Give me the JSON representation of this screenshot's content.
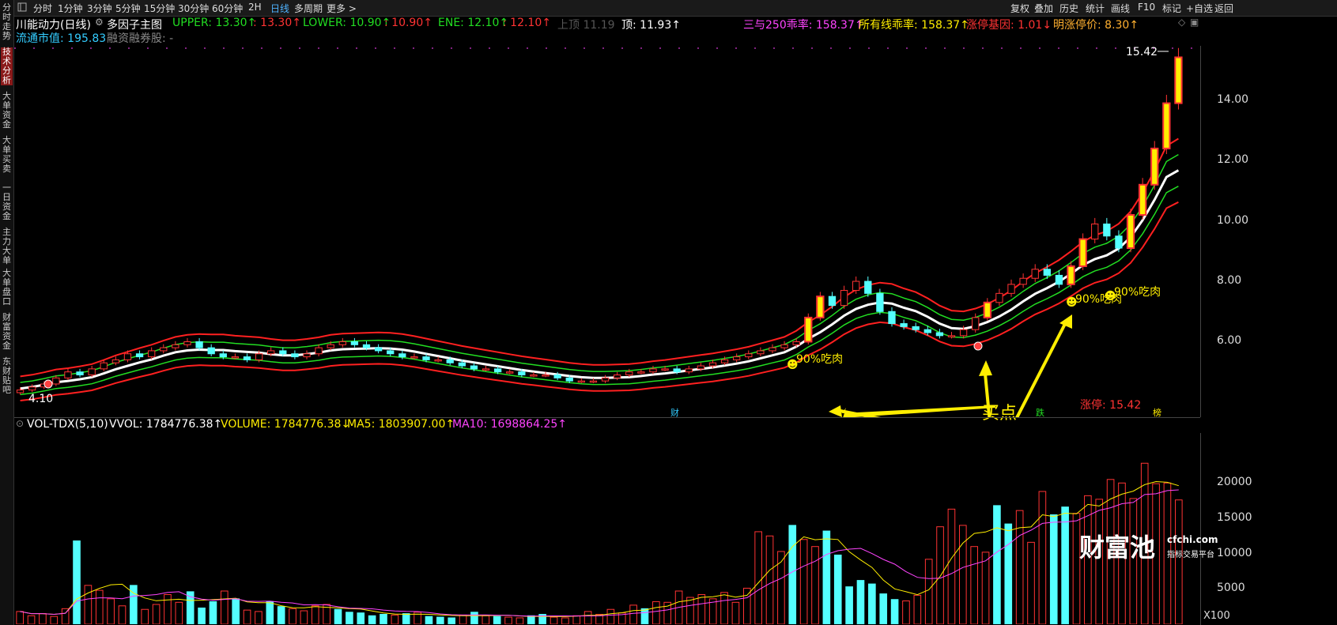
{
  "toolbar": {
    "left_icon": "layout-icon",
    "periods": [
      "分时",
      "1分钟",
      "3分钟",
      "5分钟",
      "15分钟",
      "30分钟",
      "60分钟",
      "2H",
      "日线",
      "多周期",
      "更多 >"
    ],
    "active_period": "日线",
    "right_items": [
      "复权",
      "叠加",
      "历史",
      "统计",
      "画线",
      "F10",
      "标记",
      "+自选",
      "返回"
    ]
  },
  "left_tabs": [
    "分时走势",
    "技术分析",
    "大单资金",
    "大单买卖",
    "一日资金",
    "主力大单",
    "大单盘口",
    "财富资金",
    "东财贴吧"
  ],
  "active_left_tab": "技术分析",
  "info_row1": {
    "stock_name": "川能动力(日线)",
    "factor_label": "多因子主图",
    "upper": "UPPER: 13.30↑",
    "upper2": ": 13.30↑",
    "lower": "LOWER: 10.90↑",
    "lower2": ": 10.90↑",
    "ene": "ENE: 12.10↑",
    "ene2": ": 12.10↑",
    "top": "顶: 11.93↑",
    "faded": "上顶 11.19",
    "sanyu": "三与250乖率: 158.37↑",
    "all_line": "所有线乖率: 158.37↑",
    "limit_gene": "涨停基因: 1.01↓",
    "next_limit": "明涨停价: 8.30↑"
  },
  "info_row2": {
    "float_cap": "流通市值: 195.83",
    "margin": "融资融券股: -"
  },
  "y_axis_main": [
    "14.00",
    "12.00",
    "10.00",
    "8.00",
    "6.00"
  ],
  "high_label": "15.42",
  "low_label": "4.10",
  "annotations": {
    "eat1": "90%吃肉",
    "eat2": "90%吃肉",
    "eat3": "90%吃肉",
    "buy_point": "买点",
    "limit_up": "涨停: 15.42",
    "marker_cai": "财",
    "marker_die": "跌",
    "marker_bang": "榜"
  },
  "vol_header": {
    "name": "VOL-TDX(5,10)",
    "vvol": "VVOL: 1784776.38↑",
    "volume": "VOLUME: 1784776.38↓",
    "ma5": "MA5: 1803907.00↑",
    "ma10": "MA10: 1698864.25↑"
  },
  "y_axis_vol": [
    "20000",
    "15000",
    "10000",
    "5000"
  ],
  "vol_unit": "X100",
  "watermark": {
    "brand": "财富池",
    "site": "cfchi.com",
    "tagline": "指标交易平台"
  },
  "colors": {
    "up": "#ff3333",
    "down": "#54ffff",
    "upper": "#ff2020",
    "mid": "#ffffff",
    "lower": "#22dd22",
    "yellow": "#ffee00",
    "magenta": "#ff44ff",
    "cyan": "#33ccff"
  },
  "chart_data": {
    "type": "candlestick",
    "y_range": [
      3.5,
      15.8
    ],
    "candles_close_approx": [
      4.4,
      4.5,
      4.6,
      4.8,
      5.0,
      4.9,
      5.1,
      5.3,
      5.4,
      5.6,
      5.5,
      5.7,
      5.8,
      5.9,
      6.0,
      5.8,
      5.6,
      5.5,
      5.5,
      5.4,
      5.6,
      5.7,
      5.6,
      5.5,
      5.6,
      5.8,
      5.9,
      6.0,
      5.9,
      5.8,
      5.7,
      5.6,
      5.5,
      5.5,
      5.4,
      5.4,
      5.3,
      5.2,
      5.1,
      5.1,
      5.0,
      5.0,
      4.9,
      4.9,
      4.9,
      4.8,
      4.7,
      4.7,
      4.7,
      4.8,
      4.9,
      5.0,
      5.0,
      5.1,
      5.1,
      5.0,
      5.1,
      5.2,
      5.3,
      5.4,
      5.5,
      5.6,
      5.7,
      5.8,
      5.9,
      6.0,
      6.8,
      7.5,
      7.2,
      7.7,
      8.0,
      7.6,
      7.0,
      6.6,
      6.5,
      6.4,
      6.3,
      6.2,
      6.2,
      6.4,
      6.8,
      7.3,
      7.6,
      7.9,
      8.1,
      8.4,
      8.2,
      7.9,
      8.5,
      9.4,
      9.9,
      9.5,
      9.1,
      10.2,
      11.2,
      12.4,
      13.9,
      15.42
    ],
    "volume_x100": [
      1800,
      1200,
      1500,
      1100,
      2200,
      11800,
      5500,
      4800,
      3600,
      2600,
      5500,
      2100,
      2800,
      4200,
      3100,
      4600,
      2300,
      3200,
      4700,
      3600,
      2000,
      1800,
      3200,
      2500,
      2200,
      1900,
      2600,
      2800,
      2100,
      1700,
      1600,
      1200,
      1400,
      1300,
      1500,
      1700,
      1100,
      1000,
      900,
      1300,
      1700,
      1200,
      1100,
      1000,
      900,
      1200,
      1400,
      1000,
      900,
      1200,
      1800,
      1400,
      2100,
      1600,
      2700,
      2200,
      3200,
      3100,
      4700,
      3800,
      4200,
      3600,
      4500,
      3100,
      5100,
      13100,
      12500,
      10300,
      14000,
      12000,
      11000,
      13200,
      9800,
      5300,
      6200,
      5700,
      4300,
      3500,
      3300,
      4100,
      9200,
      13800,
      16300,
      14000,
      11000,
      10200,
      16800,
      14200,
      16100,
      11600,
      18800,
      15500,
      16600,
      15700,
      18200,
      17700,
      20500,
      20000,
      17800,
      22800,
      19900,
      20000,
      17600
    ],
    "ma_volume_notes": "MA5 yellow, MA10 magenta overlay on volume"
  }
}
